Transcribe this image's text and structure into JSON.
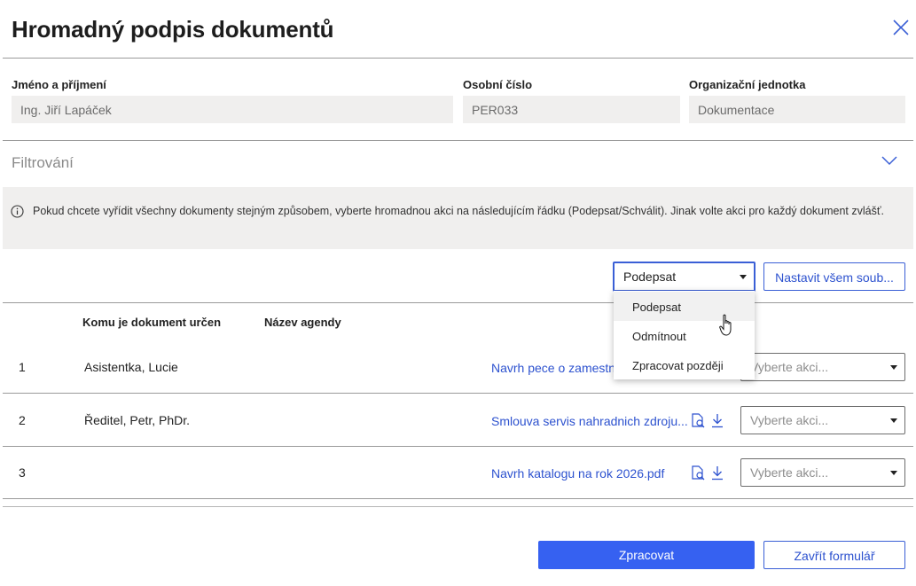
{
  "dialog": {
    "title": "Hromadný podpis dokumentů",
    "close_icon": "close-icon"
  },
  "fields": {
    "name": {
      "label": "Jméno a příjmení",
      "value": "Ing. Jiří Lapáček"
    },
    "personal_number": {
      "label": "Osobní číslo",
      "value": "PER033"
    },
    "org_unit": {
      "label": "Organizační jednotka",
      "value": "Dokumentace"
    }
  },
  "filter": {
    "label": "Filtrování",
    "chevron_icon": "chevron-down-icon"
  },
  "info": {
    "icon": "info-icon",
    "text": "Pokud chcete vyřídit všechny dokumenty stejným způsobem, vyberte hromadnou akci na následujícím řádku (Podepsat/Schválit). Jinak volte akci pro každý dokument zvlášť."
  },
  "bulk": {
    "selected": "Podepsat",
    "apply_label": "Nastavit všem soub...",
    "options": [
      "Podepsat",
      "Odmítnout",
      "Zpracovat později"
    ],
    "hovered_option": "Podepsat"
  },
  "table": {
    "headers": {
      "recipient": "Komu je dokument určen",
      "agenda": "Název agendy"
    },
    "rows": [
      {
        "num": "1",
        "recipient": "Asistentka, Lucie",
        "document": "Navrh pece o zamestn",
        "action_placeholder": "Vyberte akci..."
      },
      {
        "num": "2",
        "recipient": "Ředitel, Petr, PhDr.",
        "document": "Smlouva servis nahradnich zdroju...",
        "action_placeholder": "Vyberte akci..."
      },
      {
        "num": "3",
        "recipient": "",
        "document": "Navrh katalogu na rok 2026.pdf",
        "action_placeholder": "Vyberte akci..."
      }
    ]
  },
  "footer": {
    "process_label": "Zpracovat",
    "close_label": "Zavřít formulář"
  },
  "colors": {
    "accent": "#3661f1",
    "link": "#2d52cf",
    "field_bg": "#f0efee",
    "border": "#9a9a9a"
  }
}
